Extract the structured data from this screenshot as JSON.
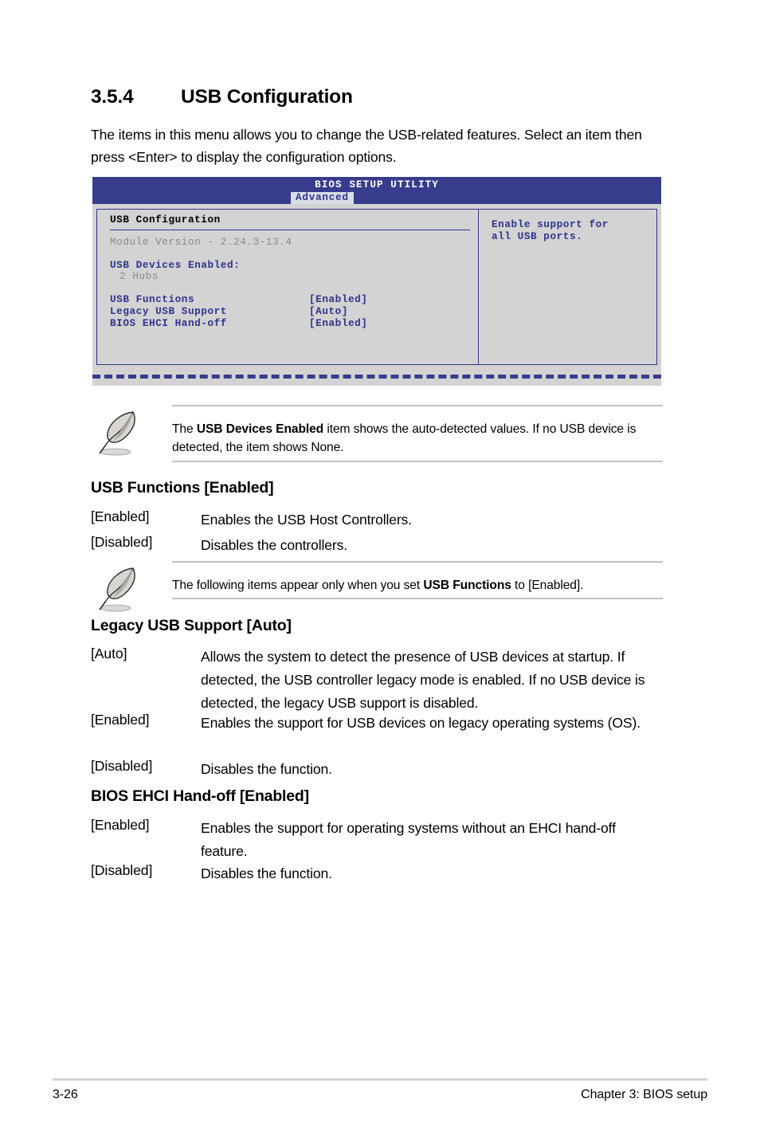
{
  "heading": {
    "number": "3.5.4",
    "title": "USB Configuration"
  },
  "intro": "The items in this menu allows you to change the USB-related features. Select an item then press <Enter> to display the configuration options.",
  "bios_screen": {
    "title": "BIOS SETUP UTILITY",
    "active_tab": "Advanced",
    "panel_title": "USB Configuration",
    "module_version": "Module Version - 2.24.3-13.4",
    "devices_enabled_label": "USB Devices Enabled:",
    "devices_enabled_value": "2 Hubs",
    "items": [
      {
        "label": "USB Functions",
        "value": "[Enabled]"
      },
      {
        "label": "Legacy USB Support",
        "value": "[Auto]"
      },
      {
        "label": "BIOS EHCI Hand-off",
        "value": "[Enabled]"
      }
    ],
    "help_line1": "Enable support for",
    "help_line2": "all USB ports.",
    "colors": {
      "header_bg": "#383c8c",
      "screen_bg": "#d3d3d3",
      "accent_blue": "#2f338c",
      "tab_bg": "#d9dde6",
      "dim_gray": "#8a8a8a"
    }
  },
  "note1": {
    "before": "The ",
    "bold": "USB Devices Enabled",
    "after": " item shows the auto-detected values. If no USB device is detected, the item shows None."
  },
  "note2": {
    "before": "The following items appear only when you set ",
    "bold": "USB Functions",
    "after": " to [Enabled]."
  },
  "sections": [
    {
      "heading": "USB Functions [Enabled]",
      "rows": [
        {
          "term": "[Enabled]",
          "desc": "Enables the USB Host Controllers."
        },
        {
          "term": "[Disabled]",
          "desc": "Disables the controllers."
        }
      ]
    },
    {
      "heading": "Legacy USB Support [Auto]",
      "rows": [
        {
          "term": "[Auto]",
          "desc": "Allows the system to detect the presence of USB devices at startup. If detected, the USB controller legacy mode is enabled. If no USB device is detected, the legacy USB support is disabled."
        },
        {
          "term": "[Enabled]",
          "desc": "Enables the support for USB devices on legacy operating systems (OS)."
        },
        {
          "term": "[Disabled]",
          "desc": "Disables the function."
        }
      ]
    },
    {
      "heading": "BIOS EHCI Hand-off [Enabled]",
      "rows": [
        {
          "term": "[Enabled]",
          "desc": "Enables the support for operating systems without an EHCI hand-off feature."
        },
        {
          "term": "[Disabled]",
          "desc": "Disables the function."
        }
      ]
    }
  ],
  "footer": {
    "page_number": "3-26",
    "chapter": "Chapter 3: BIOS setup"
  }
}
